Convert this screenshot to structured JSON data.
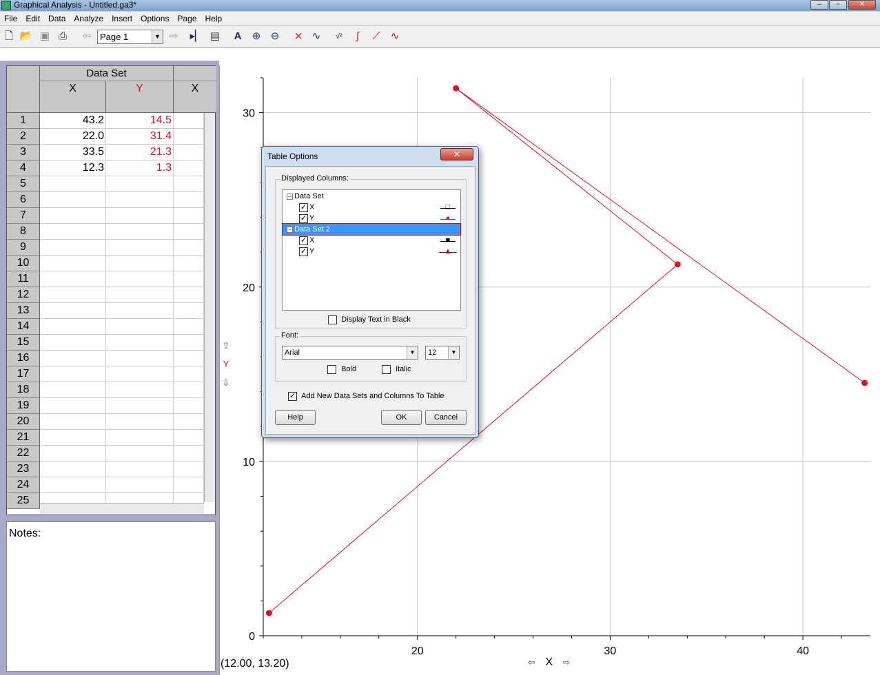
{
  "window": {
    "title": "Graphical Analysis - Untitled.ga3*"
  },
  "menu": [
    "File",
    "Edit",
    "Data",
    "Analyze",
    "Insert",
    "Options",
    "Page",
    "Help"
  ],
  "toolbar": {
    "page_value": "Page 1",
    "icons": [
      "new-file-icon",
      "open-folder-icon",
      "save-icon",
      "print-icon",
      "back-page-icon",
      "forward-page-icon",
      "step-icon",
      "calculator-icon",
      "autoscale-icon",
      "zoom-in-icon",
      "zoom-out-icon",
      "examine-icon",
      "tangent-icon",
      "statistics-icon",
      "integral-icon",
      "linear-fit-icon",
      "curve-fit-icon"
    ]
  },
  "table": {
    "dataset_title": "Data Set",
    "columns": [
      {
        "name": "X",
        "color": "#000000"
      },
      {
        "name": "Y",
        "color": "#e0102a"
      },
      {
        "name": "X",
        "color": "#000000"
      }
    ],
    "rows": [
      {
        "n": "1",
        "x": "43.2",
        "y": "14.5"
      },
      {
        "n": "2",
        "x": "22.0",
        "y": "31.4"
      },
      {
        "n": "3",
        "x": "33.5",
        "y": "21.3"
      },
      {
        "n": "4",
        "x": "12.3",
        "y": "1.3"
      },
      {
        "n": "5"
      },
      {
        "n": "6"
      },
      {
        "n": "7"
      },
      {
        "n": "8"
      },
      {
        "n": "9"
      },
      {
        "n": "10"
      },
      {
        "n": "11"
      },
      {
        "n": "12"
      },
      {
        "n": "13"
      },
      {
        "n": "14"
      },
      {
        "n": "15"
      },
      {
        "n": "16"
      },
      {
        "n": "17"
      },
      {
        "n": "18"
      },
      {
        "n": "19"
      },
      {
        "n": "20"
      },
      {
        "n": "21"
      },
      {
        "n": "22"
      },
      {
        "n": "23"
      },
      {
        "n": "24"
      },
      {
        "n": "25"
      }
    ]
  },
  "notes": {
    "label": "Notes:"
  },
  "graph": {
    "coord_readout": "(12.00, 13.20)",
    "x_label": "X",
    "y_label": "Y",
    "x_ticks": [
      "20",
      "30",
      "40"
    ],
    "y_ticks": [
      "0",
      "10",
      "20",
      "30"
    ],
    "series_color": "#e0102a"
  },
  "chart_data": {
    "type": "line",
    "x": [
      43.2,
      22.0,
      33.5,
      12.3
    ],
    "y": [
      14.5,
      31.4,
      21.3,
      1.3
    ],
    "xlabel": "X",
    "ylabel": "Y",
    "xlim": [
      12.0,
      43.5
    ],
    "ylim": [
      0,
      32
    ],
    "grid": true
  },
  "dialog": {
    "title": "Table Options",
    "close_label": "✕",
    "displayed_columns_label": "Displayed Columns:",
    "tree": [
      {
        "label": "Data Set",
        "level": 0,
        "kind": "set",
        "expander": "−",
        "selected": false
      },
      {
        "label": "X",
        "level": 1,
        "kind": "col",
        "checked": true,
        "marker": "open-square",
        "selected": false
      },
      {
        "label": "Y",
        "level": 1,
        "kind": "col",
        "checked": true,
        "marker": "filled-circle",
        "selected": false
      },
      {
        "label": "Data Set 2",
        "level": 0,
        "kind": "set",
        "expander": "−",
        "selected": true
      },
      {
        "label": "X",
        "level": 1,
        "kind": "col",
        "checked": true,
        "marker": "filled-square",
        "selected": false
      },
      {
        "label": "Y",
        "level": 1,
        "kind": "col",
        "checked": true,
        "marker": "filled-triangle",
        "selected": false
      }
    ],
    "display_black_label": "Display Text in Black",
    "display_black_checked": false,
    "font_label": "Font:",
    "font_value": "Arial",
    "size_value": "12",
    "bold_label": "Bold",
    "italic_label": "Italic",
    "add_new_label": "Add New Data Sets and Columns To Table",
    "add_new_checked": true,
    "help_label": "Help",
    "ok_label": "OK",
    "cancel_label": "Cancel"
  }
}
